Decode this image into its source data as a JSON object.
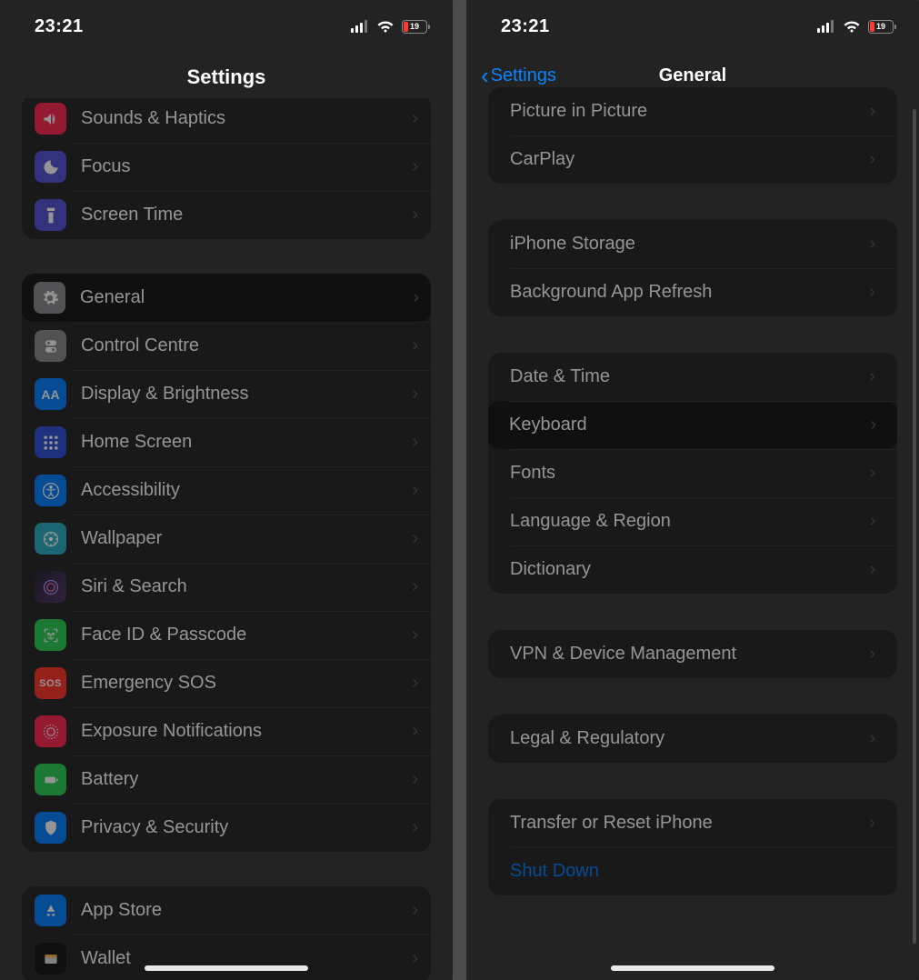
{
  "status": {
    "time": "23:21",
    "battery_pct": "19"
  },
  "left": {
    "title": "Settings",
    "groups": [
      {
        "rows": [
          {
            "id": "sounds",
            "label": "Sounds & Haptics",
            "icon": "sounds"
          },
          {
            "id": "focus",
            "label": "Focus",
            "icon": "focus"
          },
          {
            "id": "screentime",
            "label": "Screen Time",
            "icon": "screentime"
          }
        ]
      },
      {
        "rows": [
          {
            "id": "general",
            "label": "General",
            "icon": "general",
            "highlight": true
          },
          {
            "id": "control",
            "label": "Control Centre",
            "icon": "control"
          },
          {
            "id": "display",
            "label": "Display & Brightness",
            "icon": "display"
          },
          {
            "id": "home",
            "label": "Home Screen",
            "icon": "home"
          },
          {
            "id": "access",
            "label": "Accessibility",
            "icon": "access"
          },
          {
            "id": "wallpaper",
            "label": "Wallpaper",
            "icon": "wallpaper"
          },
          {
            "id": "siri",
            "label": "Siri & Search",
            "icon": "siri"
          },
          {
            "id": "faceid",
            "label": "Face ID & Passcode",
            "icon": "faceid"
          },
          {
            "id": "sos",
            "label": "Emergency SOS",
            "icon": "sos"
          },
          {
            "id": "exposure",
            "label": "Exposure Notifications",
            "icon": "exposure"
          },
          {
            "id": "battery",
            "label": "Battery",
            "icon": "battery"
          },
          {
            "id": "privacy",
            "label": "Privacy & Security",
            "icon": "privacy"
          }
        ]
      },
      {
        "rows": [
          {
            "id": "appstore",
            "label": "App Store",
            "icon": "appstore"
          },
          {
            "id": "wallet",
            "label": "Wallet",
            "icon": "wallet"
          }
        ]
      }
    ]
  },
  "right": {
    "back": "Settings",
    "title": "General",
    "groups": [
      {
        "rows": [
          {
            "id": "pip",
            "label": "Picture in Picture"
          },
          {
            "id": "carplay",
            "label": "CarPlay"
          }
        ]
      },
      {
        "rows": [
          {
            "id": "storage",
            "label": "iPhone Storage"
          },
          {
            "id": "bgrefresh",
            "label": "Background App Refresh"
          }
        ]
      },
      {
        "rows": [
          {
            "id": "datetime",
            "label": "Date & Time"
          },
          {
            "id": "keyboard",
            "label": "Keyboard",
            "highlight": true
          },
          {
            "id": "fonts",
            "label": "Fonts"
          },
          {
            "id": "langregion",
            "label": "Language & Region"
          },
          {
            "id": "dictionary",
            "label": "Dictionary"
          }
        ]
      },
      {
        "rows": [
          {
            "id": "vpn",
            "label": "VPN & Device Management"
          }
        ]
      },
      {
        "rows": [
          {
            "id": "legal",
            "label": "Legal & Regulatory"
          }
        ]
      },
      {
        "rows": [
          {
            "id": "transfer",
            "label": "Transfer or Reset iPhone"
          },
          {
            "id": "shutdown",
            "label": "Shut Down",
            "link": true
          }
        ]
      }
    ]
  }
}
